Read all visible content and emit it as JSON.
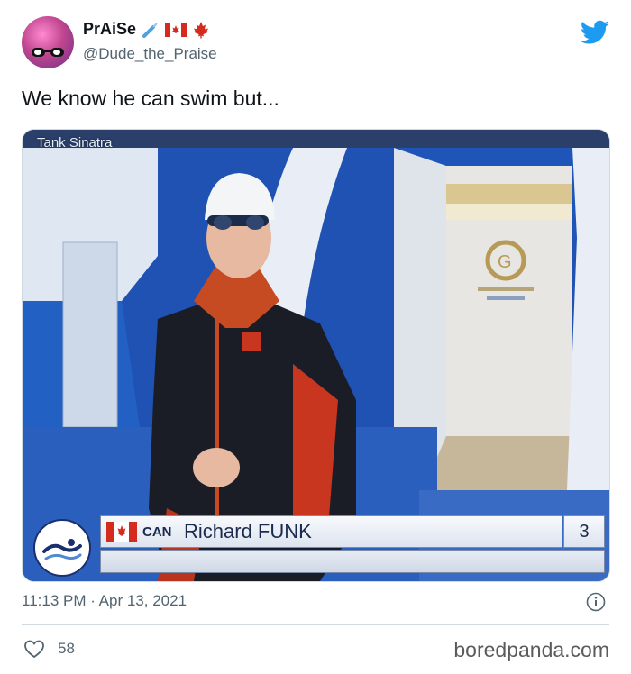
{
  "user": {
    "display_name": "PrAiSe",
    "handle": "@Dude_the_Praise",
    "name_emojis": [
      "syringe-icon",
      "canada-flag-icon",
      "maple-leaf-icon"
    ]
  },
  "tweet": {
    "text": "We know he can swim but...",
    "timestamp": "11:13 PM · Apr 13, 2021",
    "likes": "58"
  },
  "media": {
    "watermark": "Tank Sinatra",
    "scoreboard": {
      "country": "CAN",
      "athlete": "Richard FUNK",
      "lane": "3"
    }
  },
  "footer": {
    "site": "boredpanda.com"
  },
  "colors": {
    "twitter_blue": "#1d9bf0",
    "secondary_text": "#536471",
    "pool_blue": "#1d4da8",
    "canada_red": "#d52b1e"
  }
}
